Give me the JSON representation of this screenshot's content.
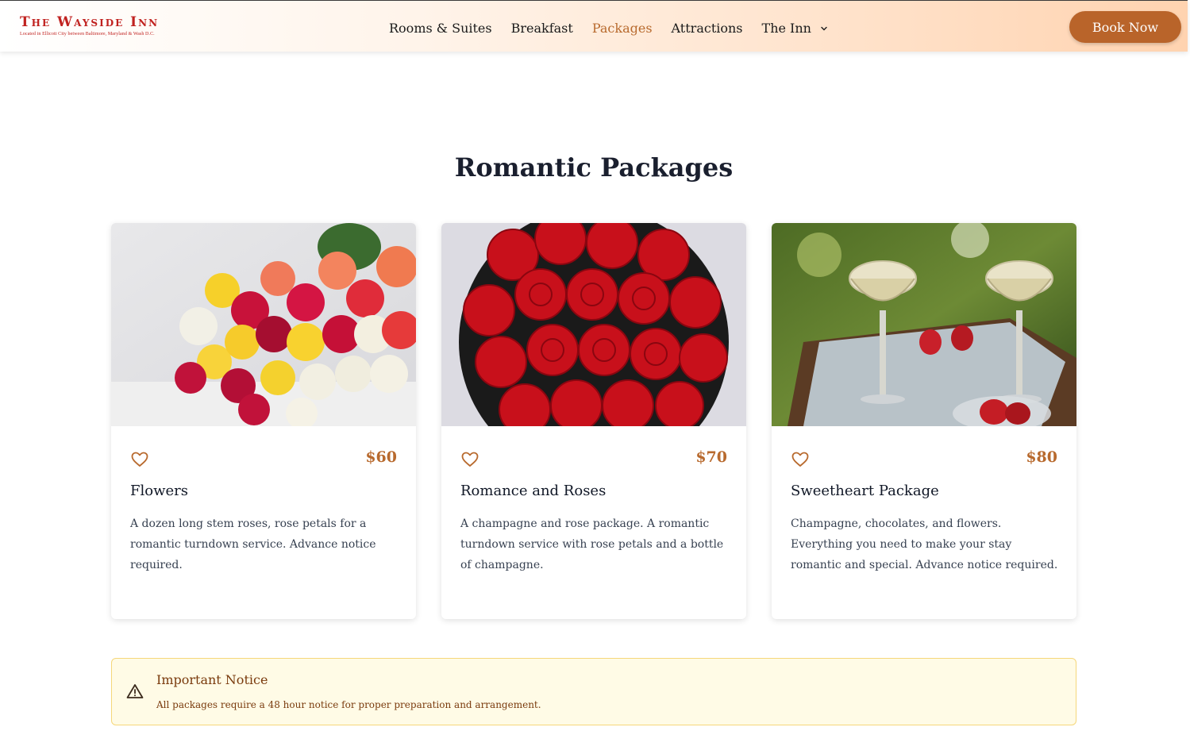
{
  "header": {
    "logo_title": "The Wayside Inn",
    "logo_subtitle": "Located in Ellicott City between Baltimore, Maryland & Wash D.C.",
    "nav": [
      {
        "label": "Rooms & Suites",
        "active": false
      },
      {
        "label": "Breakfast",
        "active": false
      },
      {
        "label": "Packages",
        "active": true
      },
      {
        "label": "Attractions",
        "active": false
      },
      {
        "label": "The Inn",
        "active": false,
        "has_dropdown": true
      }
    ],
    "book_button": "Book Now"
  },
  "page_title": "Romantic Packages",
  "packages": [
    {
      "title": "Flowers",
      "price": "$60",
      "description": "A dozen long stem roses, rose petals for a romantic turndown service. Advance notice required.",
      "image": "mixed-rose-bouquet",
      "icon": "heart-icon"
    },
    {
      "title": "Romance and Roses",
      "price": "$70",
      "description": "A champagne and rose package. A romantic turndown service with rose petals and a bottle of champagne.",
      "image": "red-roses-box",
      "icon": "heart-icon"
    },
    {
      "title": "Sweetheart Package",
      "price": "$80",
      "description": "Champagne, chocolates, and flowers. Everything you need to make your stay romantic and special. Advance notice required.",
      "image": "champagne-glasses-strawberries",
      "icon": "heart-icon"
    }
  ],
  "notice": {
    "title": "Important Notice",
    "text": "All packages require a 48 hour notice for proper preparation and arrangement.",
    "icon": "warning-icon"
  },
  "colors": {
    "accent": "#b9642a",
    "logo_red": "#c0211f",
    "notice_bg": "#fffbe6",
    "notice_border": "#f5d77a",
    "notice_text": "#7a3b0d"
  }
}
